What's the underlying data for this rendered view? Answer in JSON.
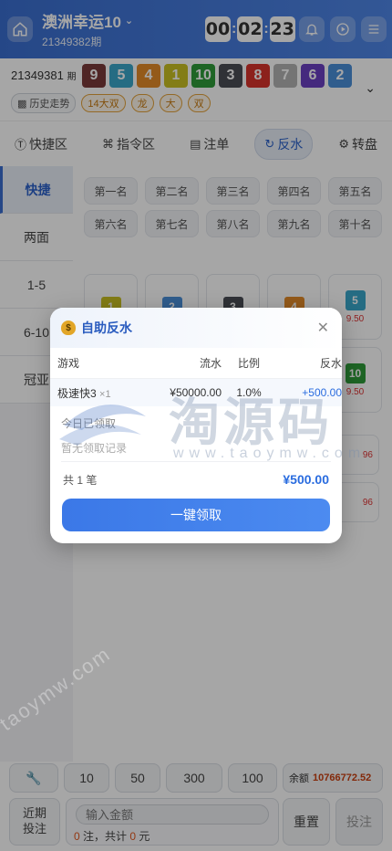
{
  "header": {
    "title": "澳洲幸运10",
    "period": "21349382期",
    "timer": [
      "00",
      "02",
      "23"
    ],
    "icons": [
      "home-icon",
      "bell-icon",
      "play-icon",
      "menu-icon"
    ]
  },
  "result": {
    "period": "21349381",
    "period_suffix": "期",
    "balls": [
      {
        "n": "9",
        "color": "#7a3a3a"
      },
      {
        "n": "5",
        "color": "#3aa7c9"
      },
      {
        "n": "4",
        "color": "#e48a28"
      },
      {
        "n": "1",
        "color": "#c9c123"
      },
      {
        "n": "10",
        "color": "#2e9b3a"
      },
      {
        "n": "3",
        "color": "#4a4e55"
      },
      {
        "n": "8",
        "color": "#d8342c"
      },
      {
        "n": "7",
        "color": "#b3b3b3"
      },
      {
        "n": "6",
        "color": "#6a3fc2"
      },
      {
        "n": "2",
        "color": "#4b8fd9"
      }
    ],
    "history_label": "历史走势",
    "tags": [
      "14大双",
      "龙",
      "大",
      "双"
    ]
  },
  "nav": {
    "items": [
      {
        "label": "快捷区",
        "icon": "dollar-icon"
      },
      {
        "label": "指令区",
        "icon": "command-icon"
      },
      {
        "label": "注单",
        "icon": "document-icon"
      },
      {
        "label": "反水",
        "icon": "refresh-icon"
      },
      {
        "label": "转盘",
        "icon": "wheel-icon"
      }
    ]
  },
  "leftmenu": [
    "快捷",
    "两面",
    "1-5",
    "6-10",
    "冠亚"
  ],
  "ranks": [
    "第一名",
    "第二名",
    "第三名",
    "第四名",
    "第五名",
    "第六名",
    "第七名",
    "第八名",
    "第九名",
    "第十名"
  ],
  "numbers": [
    {
      "n": "1",
      "color": "#c9c123"
    },
    {
      "n": "2",
      "color": "#4b8fd9"
    },
    {
      "n": "3",
      "color": "#4a4e55"
    },
    {
      "n": "4",
      "color": "#e48a28"
    },
    {
      "n": "5",
      "color": "#3aa7c9",
      "odds": "9.50"
    },
    {
      "n": "10",
      "color": "#2e9b3a",
      "odds": "9.50"
    }
  ],
  "side_odds": [
    "96",
    "96"
  ],
  "modal": {
    "title": "自助反水",
    "columns": [
      "游戏",
      "流水",
      "比例",
      "反水"
    ],
    "row": {
      "game": "极速快3",
      "mult": "×1",
      "flow": "¥50000.00",
      "ratio": "1.0%",
      "rebate": "+500.00"
    },
    "claimed_label": "今日已领取",
    "no_record": "暂无领取记录",
    "total_count": "共 1 笔",
    "total_amount": "¥500.00",
    "claim_button": "一键领取"
  },
  "watermark": {
    "text": "淘源码",
    "url": "www.taoymw.com",
    "url2": "taoymw.com"
  },
  "bottom": {
    "chips": [
      "10",
      "50",
      "300",
      "100"
    ],
    "balance_label": "余额",
    "balance_value": "10766772.52",
    "recent_label": "近期\n投注",
    "amount_placeholder": "输入金额",
    "count": "0",
    "count_label": "注，共计",
    "total": "0",
    "total_unit": "元",
    "reset_label": "重置",
    "bet_label": "投注"
  }
}
